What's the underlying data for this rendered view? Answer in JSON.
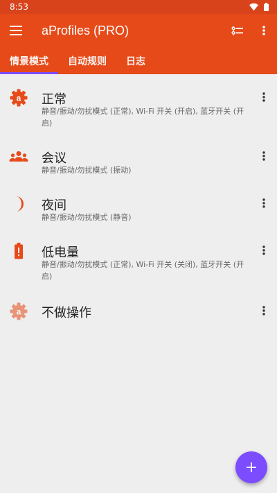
{
  "status_bar": {
    "time": "8:53"
  },
  "appbar": {
    "title": "aProfiles (PRO)"
  },
  "tabs": [
    {
      "label": "情景模式",
      "active": true
    },
    {
      "label": "自动规则",
      "active": false
    },
    {
      "label": "日志",
      "active": false
    }
  ],
  "profiles": [
    {
      "name": "正常",
      "desc": "静音/振动/勿扰模式 (正常), Wi-Fi 开关 (开启), 蓝牙开关 (开启)",
      "icon": "gear-a-icon"
    },
    {
      "name": "会议",
      "desc": "静音/振动/勿扰模式 (振动)",
      "icon": "people-icon"
    },
    {
      "name": "夜间",
      "desc": "静音/振动/勿扰模式 (静音)",
      "icon": "moon-icon"
    },
    {
      "name": "低电量",
      "desc": "静音/振动/勿扰模式 (正常), Wi-Fi 开关 (关闭), 蓝牙开关 (开启)",
      "icon": "battery-alert-icon"
    },
    {
      "name": "不做操作",
      "desc": "",
      "icon": "gear-a-faded-icon"
    }
  ],
  "colors": {
    "accent": "#e64a19",
    "status": "#d8431b",
    "fab": "#7c4dff",
    "icon": "#e64a19"
  }
}
